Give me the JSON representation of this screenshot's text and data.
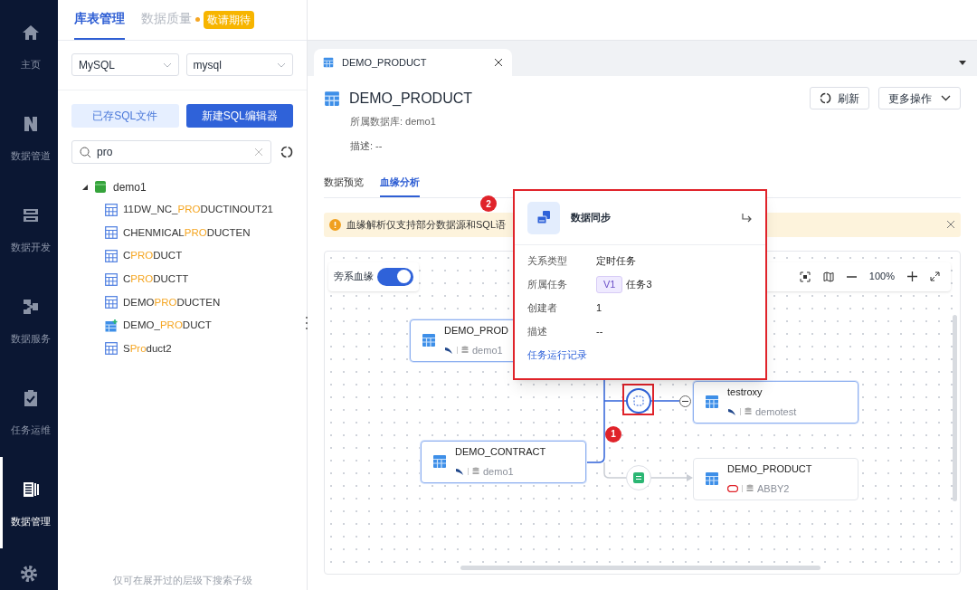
{
  "nav": {
    "items": [
      {
        "label": "主页",
        "selected": false
      },
      {
        "label": "数据管道",
        "selected": false
      },
      {
        "label": "数据开发",
        "selected": false
      },
      {
        "label": "数据服务",
        "selected": false
      },
      {
        "label": "任务运维",
        "selected": false
      },
      {
        "label": "数据管理",
        "selected": true
      }
    ]
  },
  "left_panel": {
    "tabs": [
      {
        "label": "库表管理",
        "selected": true
      },
      {
        "label": "数据质量",
        "selected": false,
        "badge": "敬请期待"
      }
    ],
    "selects": [
      "MySQL",
      "mysql"
    ],
    "buttons": [
      {
        "label": "已存SQL文件",
        "kind": "secondary"
      },
      {
        "label": "新建SQL编辑器",
        "kind": "primary"
      }
    ],
    "search": {
      "value": "pro"
    },
    "tree": {
      "label": "demo1",
      "expanded": true,
      "children": [
        {
          "prefix": "11DW_NC_",
          "match": "PRO",
          "suffix": "DUCTINOUT21",
          "kind": "table"
        },
        {
          "prefix": "CHENMICAL",
          "match": "PRO",
          "suffix": "DUCTEN",
          "kind": "table"
        },
        {
          "prefix": "C",
          "match": "PRO",
          "suffix": "DUCT",
          "kind": "table"
        },
        {
          "prefix": "C",
          "match": "PRO",
          "suffix": "DUCTT",
          "kind": "table"
        },
        {
          "prefix": "DEMO",
          "match": "PRO",
          "suffix": "DUCTEN",
          "kind": "table"
        },
        {
          "prefix": "DEMO_",
          "match": "PRO",
          "suffix": "DUCT",
          "kind": "synced"
        },
        {
          "prefix": "S",
          "match": "Pro",
          "suffix": "duct2",
          "kind": "table"
        }
      ]
    },
    "footer": "仅可在展开过的层级下搜索子级"
  },
  "editor_tabs": [
    {
      "label": "DEMO_PRODUCT",
      "selected": true
    }
  ],
  "detail": {
    "title": "DEMO_PRODUCT",
    "actions": [
      "刷新",
      "更多操作"
    ],
    "database": "所属数据库: demo1",
    "description": "描述: --",
    "tabs": [
      {
        "label": "数据预览",
        "selected": false
      },
      {
        "label": "血缘分析",
        "selected": true
      }
    ],
    "notice": "血缘解析仅支持部分数据源和SQL语"
  },
  "lineage": {
    "toggle": {
      "label": "旁系血缘",
      "on": true
    },
    "zoom": "100%",
    "nodes": [
      {
        "name": "DEMO_PROD",
        "source": "demo1",
        "kind": "mysql",
        "highlighted": true
      },
      {
        "name": "DEMO_CONTRACT",
        "source": "demo1",
        "kind": "mysql",
        "highlighted": true
      },
      {
        "name": "testroxy",
        "source": "demotest",
        "kind": "mysql",
        "highlighted": true
      },
      {
        "name": "DEMO_PRODUCT",
        "source": "ABBY2",
        "kind": "oracle",
        "highlighted": false
      }
    ]
  },
  "popup": {
    "title": "数据同步",
    "fields": [
      {
        "label": "关系类型",
        "value": "定时任务"
      },
      {
        "label": "所属任务",
        "tag": "V1",
        "value": "任务3"
      },
      {
        "label": "创建者",
        "value": "1"
      },
      {
        "label": "描述",
        "value": "--"
      }
    ],
    "link": "任务运行记录"
  },
  "markers": [
    "1",
    "2"
  ]
}
